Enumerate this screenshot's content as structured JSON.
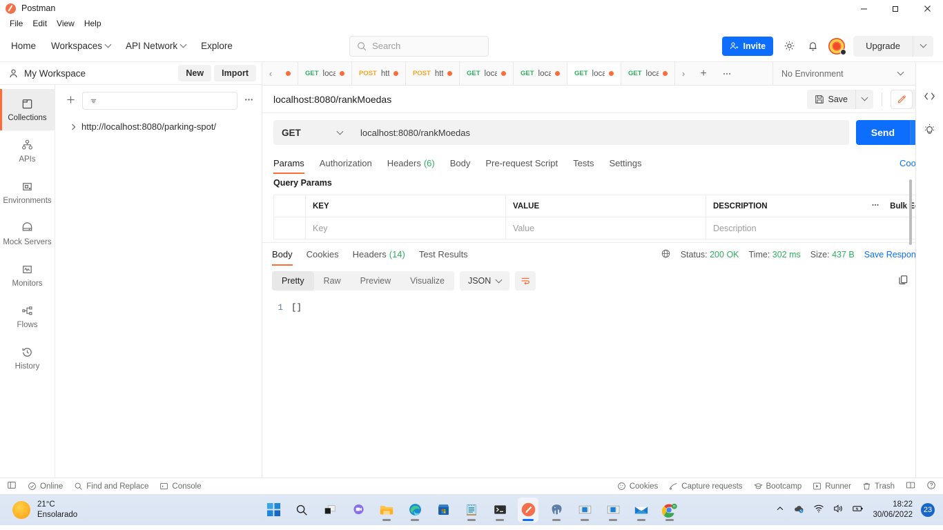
{
  "window": {
    "app_title": "Postman",
    "minimize": "–",
    "maximize": "❐",
    "close": "✕"
  },
  "menubar": {
    "items": [
      "File",
      "Edit",
      "View",
      "Help"
    ]
  },
  "topnav": {
    "links": [
      {
        "label": "Home",
        "caret": false
      },
      {
        "label": "Workspaces",
        "caret": true
      },
      {
        "label": "API Network",
        "caret": true
      },
      {
        "label": "Explore",
        "caret": false
      }
    ],
    "search_placeholder": "Search",
    "invite_label": "Invite",
    "upgrade_label": "Upgrade",
    "icons": {
      "settings": "gear-icon",
      "notifications": "bell-icon",
      "avatar": "user-avatar"
    }
  },
  "workspace": {
    "name": "My Workspace",
    "new_label": "New",
    "import_label": "Import"
  },
  "rail": {
    "items": [
      {
        "label": "Collections",
        "icon": "collections-icon",
        "active": true
      },
      {
        "label": "APIs",
        "icon": "apis-icon",
        "active": false
      },
      {
        "label": "Environments",
        "icon": "environments-icon",
        "active": false
      },
      {
        "label": "Mock Servers",
        "icon": "mock-servers-icon",
        "active": false
      },
      {
        "label": "Monitors",
        "icon": "monitors-icon",
        "active": false
      },
      {
        "label": "Flows",
        "icon": "flows-icon",
        "active": false
      },
      {
        "label": "History",
        "icon": "history-icon",
        "active": false
      }
    ]
  },
  "collections": {
    "filter_placeholder": "",
    "items": [
      {
        "name": "http://localhost:8080/parking-spot/"
      }
    ]
  },
  "tabbar": {
    "tabs": [
      {
        "verb": "",
        "name": "",
        "unsaved": true,
        "active": false
      },
      {
        "verb": "GET",
        "name": "loca",
        "unsaved": true,
        "active": false
      },
      {
        "verb": "POST",
        "name": "htt",
        "unsaved": true,
        "active": false
      },
      {
        "verb": "POST",
        "name": "htt",
        "unsaved": true,
        "active": false
      },
      {
        "verb": "GET",
        "name": "loca",
        "unsaved": true,
        "active": false
      },
      {
        "verb": "GET",
        "name": "loca",
        "unsaved": true,
        "active": false
      },
      {
        "verb": "GET",
        "name": "loca",
        "unsaved": true,
        "active": true
      },
      {
        "verb": "GET",
        "name": "loca",
        "unsaved": true,
        "active": false
      }
    ],
    "environment": "No Environment"
  },
  "request": {
    "title": "localhost:8080/rankMoedas",
    "save_label": "Save",
    "method": "GET",
    "url": "localhost:8080/rankMoedas",
    "send_label": "Send",
    "tabs": [
      {
        "label": "Params",
        "count": "",
        "active": true
      },
      {
        "label": "Authorization",
        "count": "",
        "active": false
      },
      {
        "label": "Headers",
        "count": "(6)",
        "active": false
      },
      {
        "label": "Body",
        "count": "",
        "active": false
      },
      {
        "label": "Pre-request Script",
        "count": "",
        "active": false
      },
      {
        "label": "Tests",
        "count": "",
        "active": false
      },
      {
        "label": "Settings",
        "count": "",
        "active": false
      }
    ],
    "cookies_link": "Cookies",
    "query_params_label": "Query Params",
    "table": {
      "headers": [
        "KEY",
        "VALUE",
        "DESCRIPTION"
      ],
      "bulk_edit_label": "Bulk Edit",
      "rows": [
        {
          "key": "Key",
          "value": "Value",
          "description": "Description"
        }
      ]
    }
  },
  "response": {
    "tabs": [
      {
        "label": "Body",
        "count": "",
        "active": true
      },
      {
        "label": "Cookies",
        "count": "",
        "active": false
      },
      {
        "label": "Headers",
        "count": "(14)",
        "active": false
      },
      {
        "label": "Test Results",
        "count": "",
        "active": false
      }
    ],
    "status_label": "Status:",
    "status_value": "200 OK",
    "time_label": "Time:",
    "time_value": "302 ms",
    "size_label": "Size:",
    "size_value": "437 B",
    "save_response_label": "Save Response",
    "view_modes": [
      {
        "label": "Pretty",
        "active": true
      },
      {
        "label": "Raw",
        "active": false
      },
      {
        "label": "Preview",
        "active": false
      },
      {
        "label": "Visualize",
        "active": false
      }
    ],
    "format": "JSON",
    "body_lines": [
      {
        "num": "1",
        "text": "[]"
      }
    ]
  },
  "statusbar": {
    "left": [
      {
        "label": "Online",
        "icon": "check-circle-icon"
      },
      {
        "label": "Find and Replace",
        "icon": "search-icon"
      },
      {
        "label": "Console",
        "icon": "console-icon"
      }
    ],
    "right": [
      {
        "label": "Cookies",
        "icon": "cookie-icon"
      },
      {
        "label": "Capture requests",
        "icon": "capture-icon"
      },
      {
        "label": "Bootcamp",
        "icon": "bootcamp-icon"
      },
      {
        "label": "Runner",
        "icon": "runner-icon"
      },
      {
        "label": "Trash",
        "icon": "trash-icon"
      }
    ]
  },
  "taskbar": {
    "weather_temp": "21°C",
    "weather_desc": "Ensolarado",
    "apps": [
      {
        "name": "start-icon",
        "open": false,
        "active": false
      },
      {
        "name": "search-icon",
        "open": false,
        "active": false
      },
      {
        "name": "task-view-icon",
        "open": false,
        "active": false
      },
      {
        "name": "chat-icon",
        "open": false,
        "active": false
      },
      {
        "name": "file-explorer-icon",
        "open": true,
        "active": false
      },
      {
        "name": "edge-icon",
        "open": true,
        "active": false
      },
      {
        "name": "microsoft-store-icon",
        "open": false,
        "active": false
      },
      {
        "name": "notepad-icon",
        "open": true,
        "active": false
      },
      {
        "name": "terminal-icon",
        "open": true,
        "active": false
      },
      {
        "name": "postman-icon",
        "open": true,
        "active": true
      },
      {
        "name": "postgresql-icon",
        "open": true,
        "active": false
      },
      {
        "name": "intellij-window-icon",
        "open": true,
        "active": false
      },
      {
        "name": "intellij-window-2-icon",
        "open": true,
        "active": false
      },
      {
        "name": "mail-icon",
        "open": true,
        "active": false
      },
      {
        "name": "chrome-icon",
        "open": true,
        "active": false
      }
    ],
    "time": "18:22",
    "date": "30/06/2022",
    "notification_count": "23"
  },
  "colors": {
    "accent_orange": "#ff6c37",
    "accent_blue": "#0d6efd",
    "status_green": "#2eaf5f",
    "method_get": "#2eaf5f",
    "method_post": "#f5a623"
  }
}
